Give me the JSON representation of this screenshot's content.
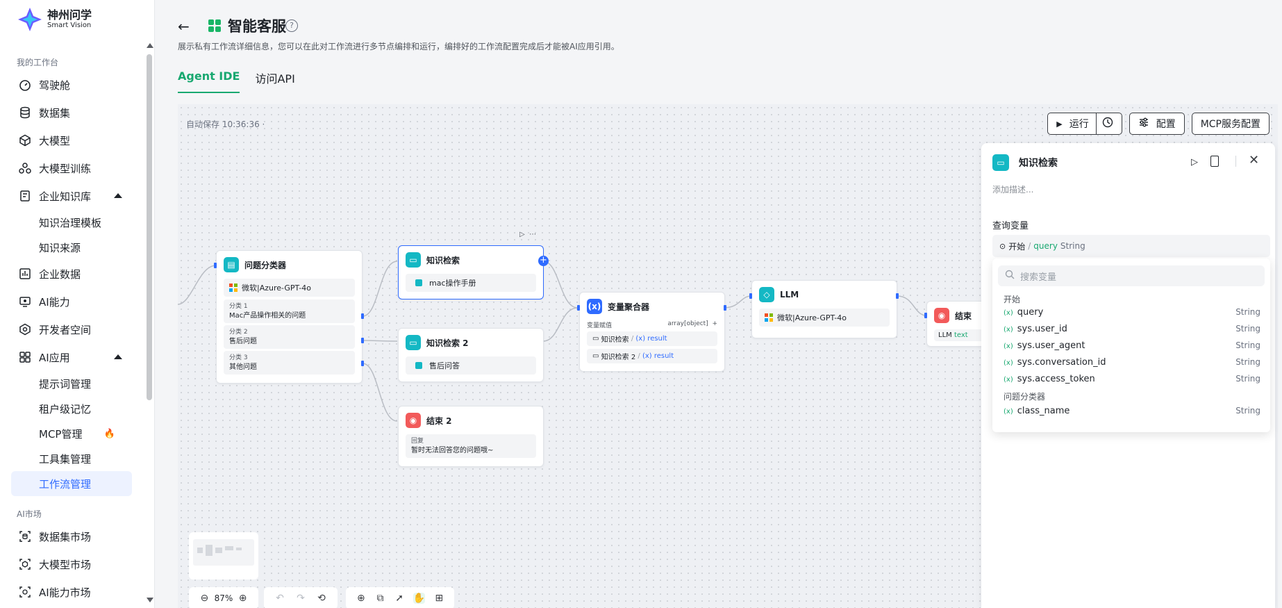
{
  "brand": {
    "title": "神州问学",
    "subtitle": "Smart Vision"
  },
  "sidebar": {
    "section_workspace": "我的工作台",
    "items": [
      {
        "label": "驾驶舱",
        "icon": "dashboard-icon"
      },
      {
        "label": "数据集",
        "icon": "database-icon"
      },
      {
        "label": "大模型",
        "icon": "cube-icon"
      },
      {
        "label": "大模型训练",
        "icon": "training-icon"
      },
      {
        "label": "企业知识库",
        "icon": "knowledge-icon"
      }
    ],
    "knowledge_sub": [
      "知识治理模板",
      "知识来源"
    ],
    "items2": [
      {
        "label": "企业数据",
        "icon": "chart-icon"
      },
      {
        "label": "AI能力",
        "icon": "ai-capability-icon"
      },
      {
        "label": "开发者空间",
        "icon": "developer-icon"
      },
      {
        "label": "AI应用",
        "icon": "apps-icon"
      }
    ],
    "app_sub": [
      "提示词管理",
      "租户级记忆",
      "MCP管理",
      "工具集管理",
      "工作流管理"
    ],
    "section_market": "AI市场",
    "market": [
      "数据集市场",
      "大模型市场",
      "AI能力市场"
    ]
  },
  "header": {
    "title": "智能客服",
    "help": "?",
    "description": "展示私有工作流详细信息，您可以在此对工作流进行多节点编排和运行，编排好的工作流配置完成后才能被AI应用引用。",
    "tabs": [
      "Agent IDE",
      "访问API"
    ]
  },
  "canvas": {
    "autosave": "自动保存 10:36:36 ·",
    "run_label": "运行",
    "config_label": "配置",
    "mcp_label": "MCP服务配置",
    "zoom": "87%"
  },
  "nodes": {
    "classifier": {
      "title": "问题分类器",
      "model": "微软|Azure-GPT-4o",
      "classes": [
        {
          "name": "分类 1",
          "value": "Mac产品操作相关的问题"
        },
        {
          "name": "分类 2",
          "value": "售后问题"
        },
        {
          "name": "分类 3",
          "value": "其他问题"
        }
      ]
    },
    "kb1": {
      "title": "知识检索",
      "item": "mac操作手册"
    },
    "kb2": {
      "title": "知识检索 2",
      "item": "售后问答"
    },
    "end2": {
      "title": "结束 2",
      "label": "回复",
      "text": "暂时无法回答您的问题哦~"
    },
    "agg": {
      "title": "变量聚合器",
      "label": "变量赋值",
      "type": "array[object]",
      "rows": [
        {
          "src": "知识检索",
          "var": "result"
        },
        {
          "src": "知识检索 2",
          "var": "result"
        }
      ]
    },
    "llm": {
      "title": "LLM",
      "model": "微软|Azure-GPT-4o"
    },
    "end": {
      "title": "结束",
      "output_src": "LLM",
      "output_var": "text"
    }
  },
  "panel": {
    "title": "知识检索",
    "description_placeholder": "添加描述...",
    "query_label": "查询变量",
    "query_src": "开始",
    "query_sep": "/",
    "query_var": "query",
    "query_type": "String",
    "search_placeholder": "搜索变量",
    "group_start": "开始",
    "start_vars": [
      {
        "name": "query",
        "type": "String"
      },
      {
        "name": "sys.user_id",
        "type": "String"
      },
      {
        "name": "sys.user_agent",
        "type": "String"
      },
      {
        "name": "sys.conversation_id",
        "type": "String"
      },
      {
        "name": "sys.access_token",
        "type": "String"
      }
    ],
    "group_classifier": "问题分类器",
    "classifier_vars": [
      {
        "name": "class_name",
        "type": "String"
      }
    ]
  },
  "colors": {
    "accent": "#18a870",
    "primary": "#2f6bff",
    "teal": "#14b8c4",
    "danger": "#f25a5a"
  }
}
